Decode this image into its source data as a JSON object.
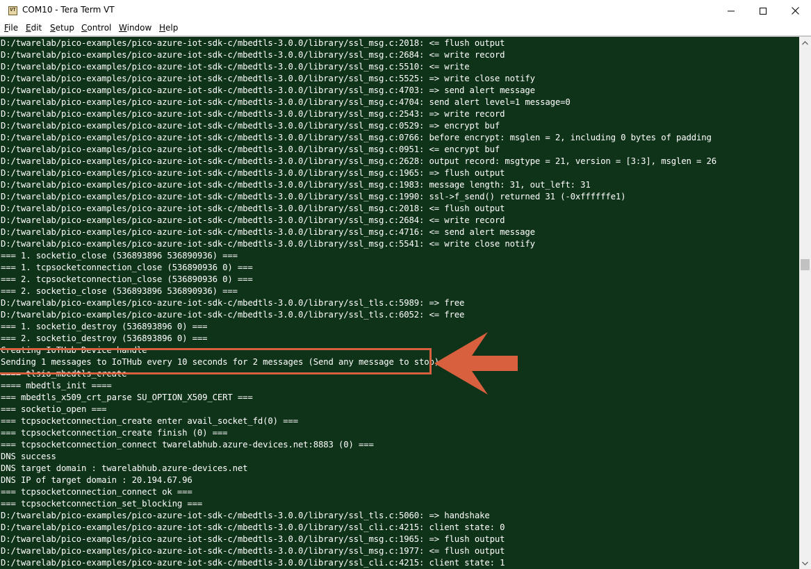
{
  "window": {
    "title": "COM10 - Tera Term VT",
    "icon_label": "VT",
    "controls": {
      "minimize_icon": "minimize-icon",
      "maximize_icon": "maximize-icon",
      "close_icon": "close-icon"
    }
  },
  "menu": {
    "items": [
      {
        "accel": "F",
        "rest": "ile"
      },
      {
        "accel": "E",
        "rest": "dit"
      },
      {
        "accel": "S",
        "rest": "etup"
      },
      {
        "accel": "C",
        "rest": "ontrol"
      },
      {
        "accel": "W",
        "rest": "indow"
      },
      {
        "accel": "H",
        "rest": "elp"
      }
    ]
  },
  "terminal": {
    "background_color": "#0f3318",
    "text_color": "#ffffff",
    "lines": [
      "D:/twarelab/pico-examples/pico-azure-iot-sdk-c/mbedtls-3.0.0/library/ssl_msg.c:2018: <= flush output",
      "D:/twarelab/pico-examples/pico-azure-iot-sdk-c/mbedtls-3.0.0/library/ssl_msg.c:2684: <= write record",
      "D:/twarelab/pico-examples/pico-azure-iot-sdk-c/mbedtls-3.0.0/library/ssl_msg.c:5510: <= write",
      "D:/twarelab/pico-examples/pico-azure-iot-sdk-c/mbedtls-3.0.0/library/ssl_msg.c:5525: => write close notify",
      "D:/twarelab/pico-examples/pico-azure-iot-sdk-c/mbedtls-3.0.0/library/ssl_msg.c:4703: => send alert message",
      "D:/twarelab/pico-examples/pico-azure-iot-sdk-c/mbedtls-3.0.0/library/ssl_msg.c:4704: send alert level=1 message=0",
      "D:/twarelab/pico-examples/pico-azure-iot-sdk-c/mbedtls-3.0.0/library/ssl_msg.c:2543: => write record",
      "D:/twarelab/pico-examples/pico-azure-iot-sdk-c/mbedtls-3.0.0/library/ssl_msg.c:0529: => encrypt buf",
      "D:/twarelab/pico-examples/pico-azure-iot-sdk-c/mbedtls-3.0.0/library/ssl_msg.c:0766: before encrypt: msglen = 2, including 0 bytes of padding",
      "D:/twarelab/pico-examples/pico-azure-iot-sdk-c/mbedtls-3.0.0/library/ssl_msg.c:0951: <= encrypt buf",
      "D:/twarelab/pico-examples/pico-azure-iot-sdk-c/mbedtls-3.0.0/library/ssl_msg.c:2628: output record: msgtype = 21, version = [3:3], msglen = 26",
      "D:/twarelab/pico-examples/pico-azure-iot-sdk-c/mbedtls-3.0.0/library/ssl_msg.c:1965: => flush output",
      "D:/twarelab/pico-examples/pico-azure-iot-sdk-c/mbedtls-3.0.0/library/ssl_msg.c:1983: message length: 31, out_left: 31",
      "D:/twarelab/pico-examples/pico-azure-iot-sdk-c/mbedtls-3.0.0/library/ssl_msg.c:1990: ssl->f_send() returned 31 (-0xffffffe1)",
      "D:/twarelab/pico-examples/pico-azure-iot-sdk-c/mbedtls-3.0.0/library/ssl_msg.c:2018: <= flush output",
      "D:/twarelab/pico-examples/pico-azure-iot-sdk-c/mbedtls-3.0.0/library/ssl_msg.c:2684: <= write record",
      "D:/twarelab/pico-examples/pico-azure-iot-sdk-c/mbedtls-3.0.0/library/ssl_msg.c:4716: <= send alert message",
      "D:/twarelab/pico-examples/pico-azure-iot-sdk-c/mbedtls-3.0.0/library/ssl_msg.c:5541: <= write close notify",
      "=== 1. socketio_close (536893896 536890936) ===",
      "=== 1. tcpsocketconnection_close (536890936 0) ===",
      "=== 2. tcpsocketconnection_close (536890936 0) ===",
      "=== 2. socketio_close (536893896 536890936) ===",
      "D:/twarelab/pico-examples/pico-azure-iot-sdk-c/mbedtls-3.0.0/library/ssl_tls.c:5989: => free",
      "D:/twarelab/pico-examples/pico-azure-iot-sdk-c/mbedtls-3.0.0/library/ssl_tls.c:6052: <= free",
      "=== 1. socketio_destroy (536893896 0) ===",
      "=== 2. socketio_destroy (536893896 0) ===",
      "Creating IoTHub Device handle",
      "Sending 1 messages to IoTHub every 10 seconds for 2 messages (Send any message to stop)",
      "==== tlsio_mbedtls_create",
      "==== mbedtls_init ====",
      "=== mbedtls_x509_crt_parse SU_OPTION_X509_CERT ===",
      "=== socketio_open ===",
      "=== tcpsocketconnection_create enter avail_socket_fd(0) ===",
      "=== tcpsocketconnection_create finish (0) ===",
      "=== tcpsocketconnection_connect twarelabhub.azure-devices.net:8883 (0) ===",
      "DNS success",
      "DNS target domain : twarelabhub.azure-devices.net",
      "DNS IP of target domain : 20.194.67.96",
      "=== tcpsocketconnection_connect ok ===",
      "=== tcpsocketconnection_set_blocking ===",
      "D:/twarelab/pico-examples/pico-azure-iot-sdk-c/mbedtls-3.0.0/library/ssl_tls.c:5060: => handshake",
      "D:/twarelab/pico-examples/pico-azure-iot-sdk-c/mbedtls-3.0.0/library/ssl_cli.c:4215: client state: 0",
      "D:/twarelab/pico-examples/pico-azure-iot-sdk-c/mbedtls-3.0.0/library/ssl_msg.c:1965: => flush output",
      "D:/twarelab/pico-examples/pico-azure-iot-sdk-c/mbedtls-3.0.0/library/ssl_msg.c:1977: <= flush output",
      "D:/twarelab/pico-examples/pico-azure-iot-sdk-c/mbedtls-3.0.0/library/ssl_cli.c:4215: client state: 1"
    ]
  },
  "annotation": {
    "highlight_color": "#d9603e",
    "arrow_icon": "left-arrow-icon",
    "highlighted_line_index": 27
  }
}
